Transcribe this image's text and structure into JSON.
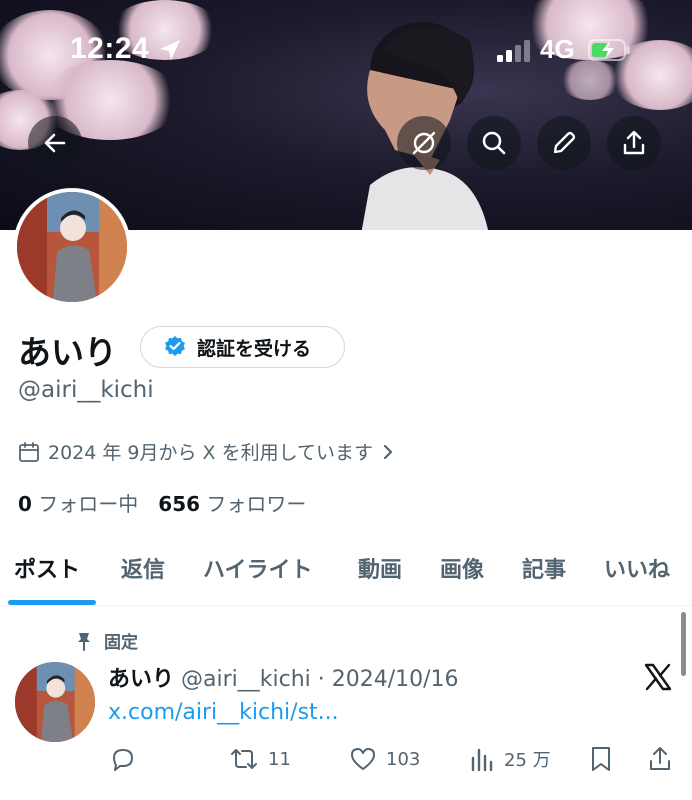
{
  "status_bar": {
    "time": "12:24",
    "network": "4G"
  },
  "profile": {
    "name": "あいり",
    "verify_label": "認証を受ける",
    "handle": "@airi__kichi",
    "joined": "2024 年 9月から X を利用しています",
    "following_count": "0",
    "following_label": "フォロー中",
    "followers_count": "656",
    "followers_label": "フォロワー"
  },
  "tabs": [
    {
      "label": "ポスト",
      "active": true
    },
    {
      "label": "返信"
    },
    {
      "label": "ハイライト"
    },
    {
      "label": "動画"
    },
    {
      "label": "画像"
    },
    {
      "label": "記事"
    },
    {
      "label": "いいね"
    }
  ],
  "post": {
    "pinned_label": "固定",
    "author_name": "あいり",
    "meta": "@airi__kichi · 2024/10/16",
    "link_text": "x.com/airi__kichi/st...",
    "retweets": "11",
    "likes": "103",
    "views": "25 万"
  },
  "colors": {
    "accent": "#1d9bf0",
    "text": "#0f1419",
    "muted": "#536471"
  },
  "icons": [
    "location-arrow-icon",
    "signal-icon",
    "battery-charging-icon",
    "back-arrow-icon",
    "grok-icon",
    "search-icon",
    "edit-pencil-icon",
    "share-icon",
    "verified-badge-icon",
    "calendar-icon",
    "chevron-right-icon",
    "pin-icon",
    "x-logo-icon",
    "reply-icon",
    "retweet-icon",
    "like-icon",
    "views-icon",
    "bookmark-icon"
  ]
}
